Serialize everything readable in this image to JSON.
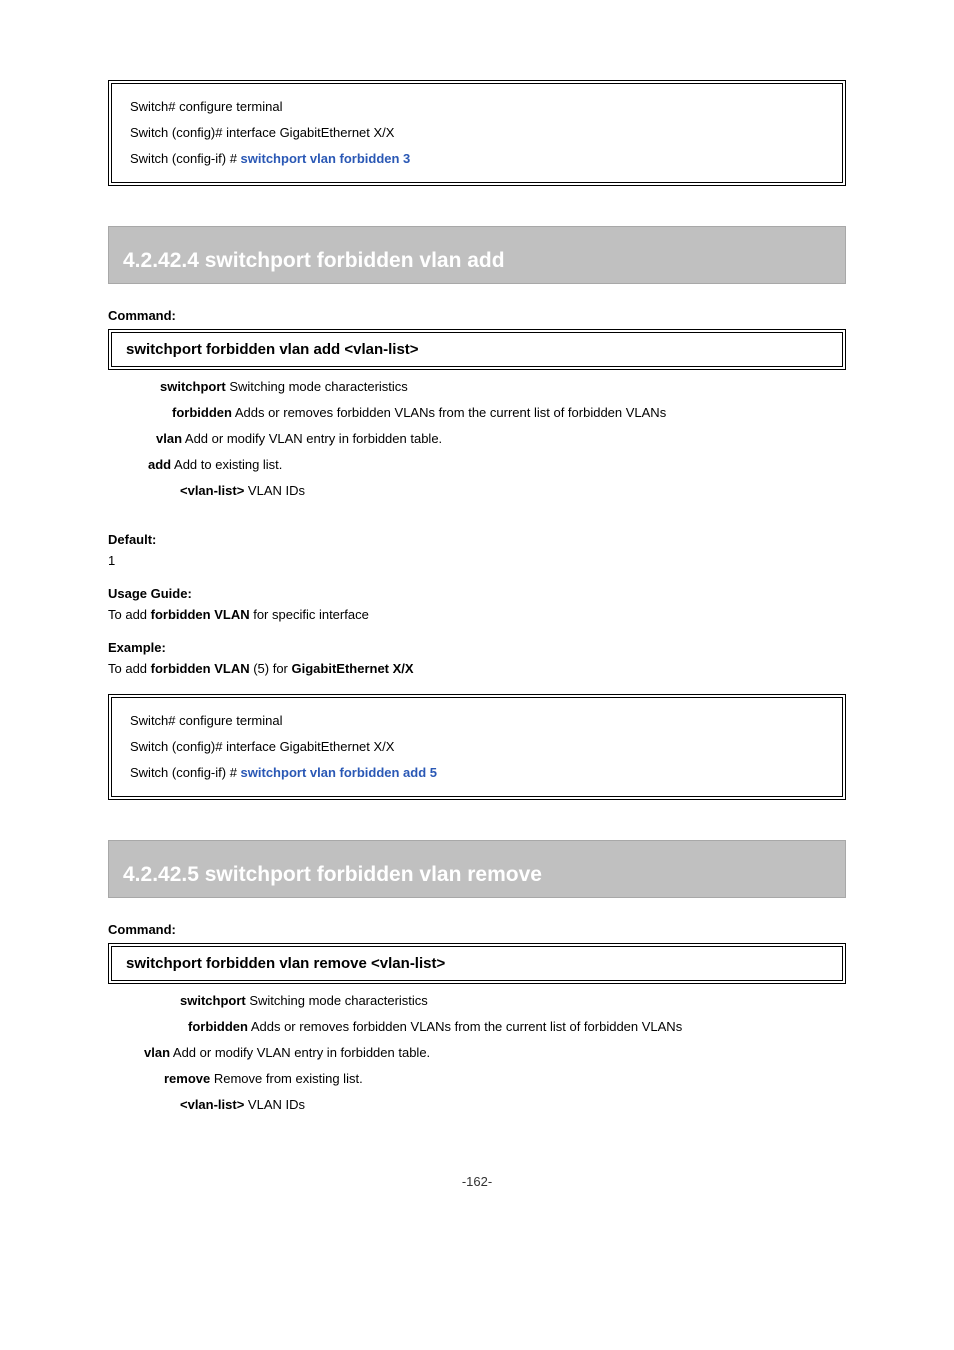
{
  "codebox1": {
    "line1": "Switch# configure terminal",
    "line2": "Switch (config)# interface GigabitEthernet X/X",
    "line3_prefix": "Switch (config-if) # ",
    "line3_cmd": "switchport vlan forbidden 3"
  },
  "section1": {
    "heading": "4.2.42.4 switchport forbidden vlan add",
    "syntax": "switchport forbidden vlan add <vlan-list>",
    "param_switchport": "switchport",
    "desc_switchport": " Switching mode characteristics",
    "param_forbidden": "forbidden",
    "desc_forbidden": " Adds or removes forbidden VLANs from the current list of forbidden VLANs",
    "param_vlan": "vlan",
    "desc_vlan": " Add or modify VLAN entry in forbidden table.",
    "param_add": "add",
    "desc_add": " Add to existing list.",
    "param_vlanlist": "<vlan-list>",
    "desc_vlanlist": " VLAN  IDs",
    "default_label": "Default:",
    "default_val": "1",
    "usage_label": "Usage Guide:",
    "usage_body_pre": "To add ",
    "usage_body_bold": "forbidden VLAN",
    "usage_body_post": " for specific interface",
    "example_label": "Example:",
    "example_body_pre": "To add ",
    "example_body_bold1": "forbidden VLAN",
    "example_body_mid": " (5) for ",
    "example_body_bold2": "GigabitEthernet X/X",
    "code": {
      "line1": "Switch# configure terminal",
      "line2": "Switch (config)# interface GigabitEthernet X/X",
      "line3_prefix": "Switch (config-if) # ",
      "line3_cmd": "switchport vlan forbidden add 5"
    }
  },
  "section2": {
    "heading": "4.2.42.5 switchport forbidden vlan remove",
    "syntax": "switchport forbidden vlan remove <vlan-list>",
    "param_switchport": "switchport",
    "desc_switchport": " Switching mode characteristics",
    "param_forbidden": "forbidden",
    "desc_forbidden": " Adds or removes forbidden VLANs from the current list of forbidden VLANs",
    "param_vlan": "vlan",
    "desc_vlan": " Add or modify VLAN entry in forbidden table.",
    "param_remove": "remove",
    "desc_remove": " Remove from existing list.",
    "param_vlanlist": "<vlan-list>",
    "desc_vlanlist": " VLAN  IDs"
  },
  "footer": "-162-"
}
